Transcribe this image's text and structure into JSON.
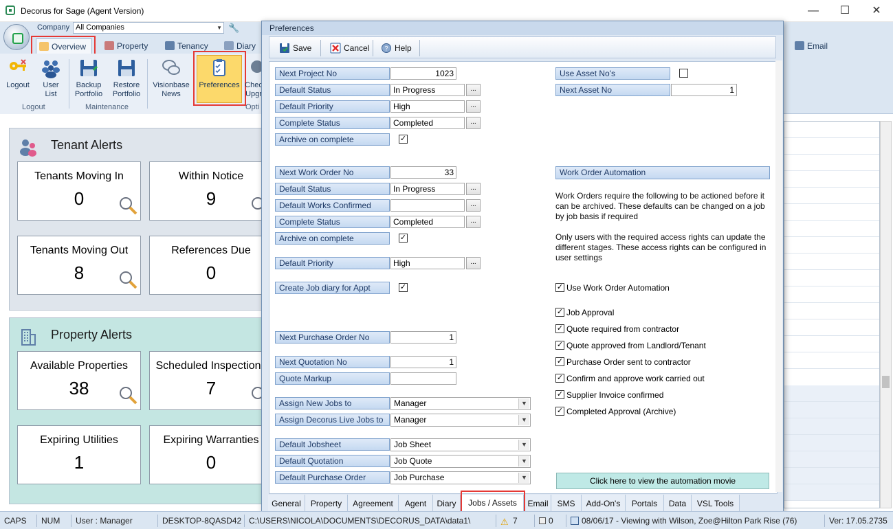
{
  "window": {
    "title": "Decorus for Sage (Agent Version)"
  },
  "ribbon": {
    "company_label": "Company",
    "company_value": "All Companies",
    "tabs": [
      {
        "label": "Overview"
      },
      {
        "label": "Property"
      },
      {
        "label": "Tenancy"
      },
      {
        "label": "Diary"
      }
    ],
    "email_tab": "Email",
    "buttons": {
      "logout": "Logout",
      "user_list_1": "User",
      "user_list_2": "List",
      "backup_1": "Backup",
      "backup_2": "Portfolio",
      "restore_1": "Restore",
      "restore_2": "Portfolio",
      "visionbase_1": "Visionbase",
      "visionbase_2": "News",
      "preferences": "Preferences",
      "check_1": "Chec",
      "check_2": "Upgr"
    },
    "groups": {
      "logout": "Logout",
      "maintenance": "Maintenance",
      "options": "Opti"
    }
  },
  "tenant_alerts": {
    "title": "Tenant Alerts",
    "cards": [
      {
        "label": "Tenants Moving In",
        "value": "0"
      },
      {
        "label": "Within Notice",
        "value": "9"
      },
      {
        "label": "Tenants Moving Out",
        "value": "8"
      },
      {
        "label": "References Due",
        "value": "0"
      }
    ]
  },
  "property_alerts": {
    "title": "Property Alerts",
    "cards": [
      {
        "label": "Available Properties",
        "value": "38"
      },
      {
        "label": "Scheduled Inspections",
        "value": "7"
      },
      {
        "label": "Expiring Utilities",
        "value": "1"
      },
      {
        "label": "Expiring Warranties",
        "value": "0"
      }
    ]
  },
  "dialog": {
    "title": "Preferences",
    "toolbar": {
      "save": "Save",
      "cancel": "Cancel",
      "help": "Help"
    },
    "project": {
      "next_no_label": "Next Project No",
      "next_no_value": "1023",
      "status_label": "Default Status",
      "status_value": "In Progress",
      "priority_label": "Default Priority",
      "priority_value": "High",
      "complete_label": "Complete Status",
      "complete_value": "Completed",
      "archive_label": "Archive on complete",
      "archive_check": "✓"
    },
    "work_order": {
      "next_no_label": "Next Work Order No",
      "next_no_value": "33",
      "status_label": "Default Status",
      "status_value": "In Progress",
      "confirmed_label": "Default Works Confirmed",
      "confirmed_value": "",
      "complete_label": "Complete Status",
      "complete_value": "Completed",
      "archive_label": "Archive on complete",
      "archive_check": "✓",
      "priority_label": "Default Priority",
      "priority_value": "High",
      "diary_label": "Create Job diary for Appt",
      "diary_check": "✓"
    },
    "purchase": {
      "next_po_label": "Next Purchase Order No",
      "next_po_value": "1",
      "next_quote_label": "Next Quotation No",
      "next_quote_value": "1",
      "markup_label": "Quote Markup",
      "markup_value": ""
    },
    "assign": {
      "new_jobs_label": "Assign New Jobs to",
      "new_jobs_value": "Manager",
      "live_jobs_label": "Assign Decorus Live Jobs to",
      "live_jobs_value": "Manager"
    },
    "defaults": {
      "jobsheet_label": "Default Jobsheet",
      "jobsheet_value": "Job Sheet",
      "quotation_label": "Default Quotation",
      "quotation_value": "Job Quote",
      "po_label": "Default Purchase Order",
      "po_value": "Job Purchase"
    },
    "assets": {
      "use_label": "Use Asset No's",
      "use_check": "",
      "next_label": "Next Asset No",
      "next_value": "1"
    },
    "automation": {
      "header": "Work Order Automation",
      "para1": "Work Orders require the following to be actioned before it can be archived. These defaults can be changed on a job by job basis if required",
      "para2": "Only users with the required access rights can update the different stages. These access rights can be configured in user settings",
      "use_label": "Use Work Order Automation",
      "use_check": "✓",
      "stages": [
        {
          "label": "Job Approval",
          "check": "✓"
        },
        {
          "label": "Quote required from contractor",
          "check": "✓"
        },
        {
          "label": "Quote approved from Landlord/Tenant",
          "check": "✓"
        },
        {
          "label": "Purchase Order sent to contractor",
          "check": "✓"
        },
        {
          "label": "Confirm and approve work carried out",
          "check": "✓"
        },
        {
          "label": "Supplier Invoice confirmed",
          "check": "✓"
        },
        {
          "label": "Completed Approval (Archive)",
          "check": "✓"
        }
      ],
      "movie_button": "Click here to view the automation movie"
    },
    "tabs": [
      "General",
      "Property",
      "Agreement",
      "Agent",
      "Diary",
      "Jobs / Assets",
      "Email",
      "SMS",
      "Add-On's",
      "Portals",
      "Data",
      "VSL Tools"
    ]
  },
  "statusbar": {
    "caps": "CAPS",
    "num": "NUM",
    "user": "User : Manager",
    "machine": "DESKTOP-8QASD42",
    "path": "C:\\USERS\\NICOLA\\DOCUMENTS\\DECORUS_DATA\\data1\\",
    "warnings": "7",
    "messages": "0",
    "activity": "08/06/17 - Viewing with Wilson, Zoe@Hilton Park Rise (76)",
    "version": "Ver: 17.05.2735"
  },
  "colors": {
    "accent_blue": "#c5d9f1",
    "highlight_red": "#e53935",
    "property_alerts_bg": "#c4e6e2"
  }
}
